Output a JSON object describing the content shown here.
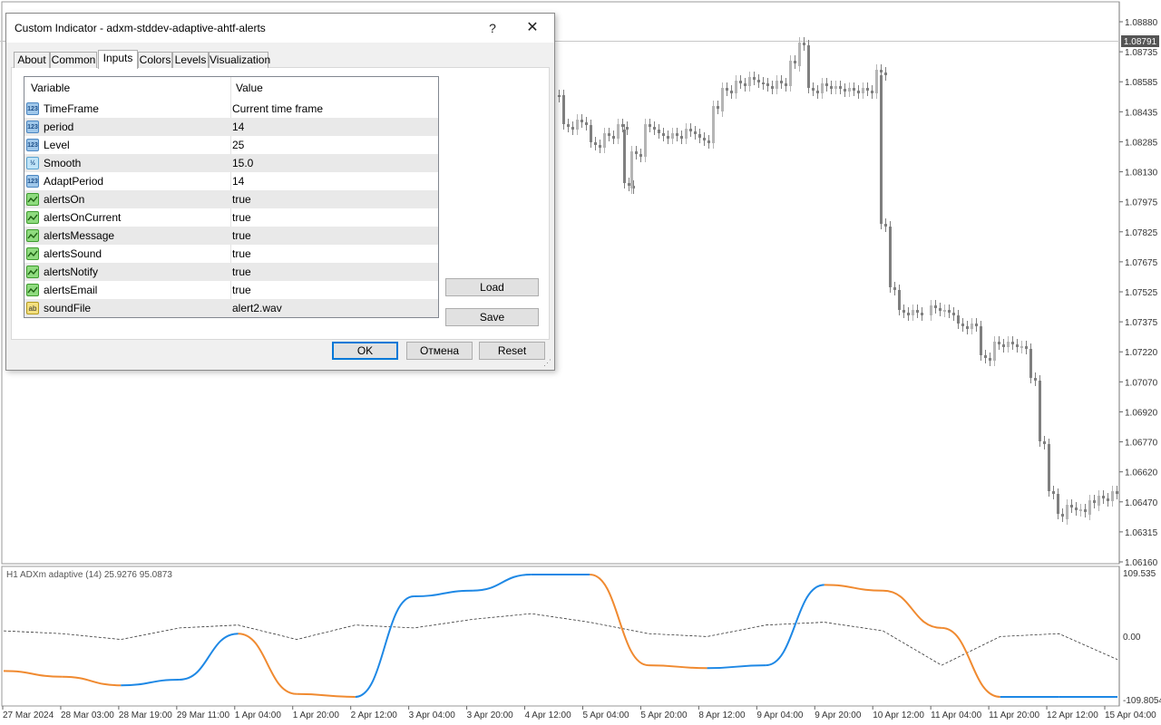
{
  "dialog": {
    "title": "Custom Indicator - adxm-stddev-adaptive-ahtf-alerts",
    "help_label": "?",
    "close_label": "✕",
    "tabs": [
      "About",
      "Common",
      "Inputs",
      "Colors",
      "Levels",
      "Visualization"
    ],
    "active_tab": "Inputs",
    "grid": {
      "headers": [
        "Variable",
        "Value"
      ],
      "rows": [
        {
          "type": "int",
          "icon": "123",
          "variable": "TimeFrame",
          "value": "Current time frame"
        },
        {
          "type": "int",
          "icon": "123",
          "variable": "period",
          "value": "14"
        },
        {
          "type": "int",
          "icon": "123",
          "variable": "Level",
          "value": "25"
        },
        {
          "type": "double",
          "icon": "½",
          "variable": "Smooth",
          "value": "15.0"
        },
        {
          "type": "int",
          "icon": "123",
          "variable": "AdaptPeriod",
          "value": "14"
        },
        {
          "type": "bool",
          "icon": "",
          "variable": "alertsOn",
          "value": "true"
        },
        {
          "type": "bool",
          "icon": "",
          "variable": "alertsOnCurrent",
          "value": "true"
        },
        {
          "type": "bool",
          "icon": "",
          "variable": "alertsMessage",
          "value": "true"
        },
        {
          "type": "bool",
          "icon": "",
          "variable": "alertsSound",
          "value": "true"
        },
        {
          "type": "bool",
          "icon": "",
          "variable": "alertsNotify",
          "value": "true"
        },
        {
          "type": "bool",
          "icon": "",
          "variable": "alertsEmail",
          "value": "true"
        },
        {
          "type": "string",
          "icon": "ab",
          "variable": "soundFile",
          "value": "alert2.wav"
        }
      ]
    },
    "load_label": "Load",
    "save_label": "Save",
    "ok_label": "OK",
    "cancel_label": "Отмена",
    "reset_label": "Reset"
  },
  "price_chart": {
    "price_axis": [
      "1.08880",
      "1.08735",
      "1.08585",
      "1.08435",
      "1.08285",
      "1.08130",
      "1.07975",
      "1.07825",
      "1.07675",
      "1.07525",
      "1.07375",
      "1.07220",
      "1.07070",
      "1.06920",
      "1.06770",
      "1.06620",
      "1.06470",
      "1.06315",
      "1.06160"
    ],
    "current_price": "1.08791",
    "candle_color": "#7f7f7f",
    "candle_up_color": "#b5b5b5"
  },
  "indicator": {
    "label": "H1 ADXm adaptive (14) 25.9276 95.0873",
    "axis": [
      "109.535",
      "0.00",
      "-109.8054"
    ],
    "rising_color": "#1e88e5",
    "falling_color": "#f08a30",
    "level_color": "#333333"
  },
  "time_axis": [
    "27 Mar 2024",
    "28 Mar 03:00",
    "28 Mar 19:00",
    "29 Mar 11:00",
    "1 Apr 04:00",
    "1 Apr 20:00",
    "2 Apr 12:00",
    "3 Apr 04:00",
    "3 Apr 20:00",
    "4 Apr 12:00",
    "5 Apr 04:00",
    "5 Apr 20:00",
    "8 Apr 12:00",
    "9 Apr 04:00",
    "9 Apr 20:00",
    "10 Apr 12:00",
    "11 Apr 04:00",
    "11 Apr 20:00",
    "12 Apr 12:00",
    "15 Apr 04:00"
  ],
  "chart_data": {
    "type": "line",
    "indicator_values": {
      "x": [
        "27 Mar 2024",
        "28 Mar 03:00",
        "28 Mar 19:00",
        "29 Mar 11:00",
        "1 Apr 04:00",
        "1 Apr 20:00",
        "2 Apr 12:00",
        "3 Apr 04:00",
        "3 Apr 20:00",
        "4 Apr 12:00",
        "5 Apr 04:00",
        "5 Apr 20:00",
        "8 Apr 12:00",
        "9 Apr 04:00",
        "9 Apr 20:00",
        "10 Apr 12:00",
        "11 Apr 04:00",
        "11 Apr 20:00",
        "12 Apr 12:00",
        "15 Apr 04:00"
      ],
      "series": [
        {
          "name": "ADXm",
          "values": [
            -60,
            -70,
            -85,
            -75,
            5,
            -100,
            -105,
            70,
            80,
            108,
            108,
            -50,
            -55,
            -50,
            90,
            80,
            15,
            -105,
            -105,
            -105
          ]
        },
        {
          "name": "Level",
          "values": [
            10,
            5,
            -5,
            15,
            20,
            -5,
            20,
            15,
            30,
            40,
            25,
            5,
            0,
            20,
            25,
            10,
            -50,
            0,
            5,
            -40
          ]
        }
      ],
      "ylim": [
        -109.8054,
        109.535
      ]
    }
  }
}
